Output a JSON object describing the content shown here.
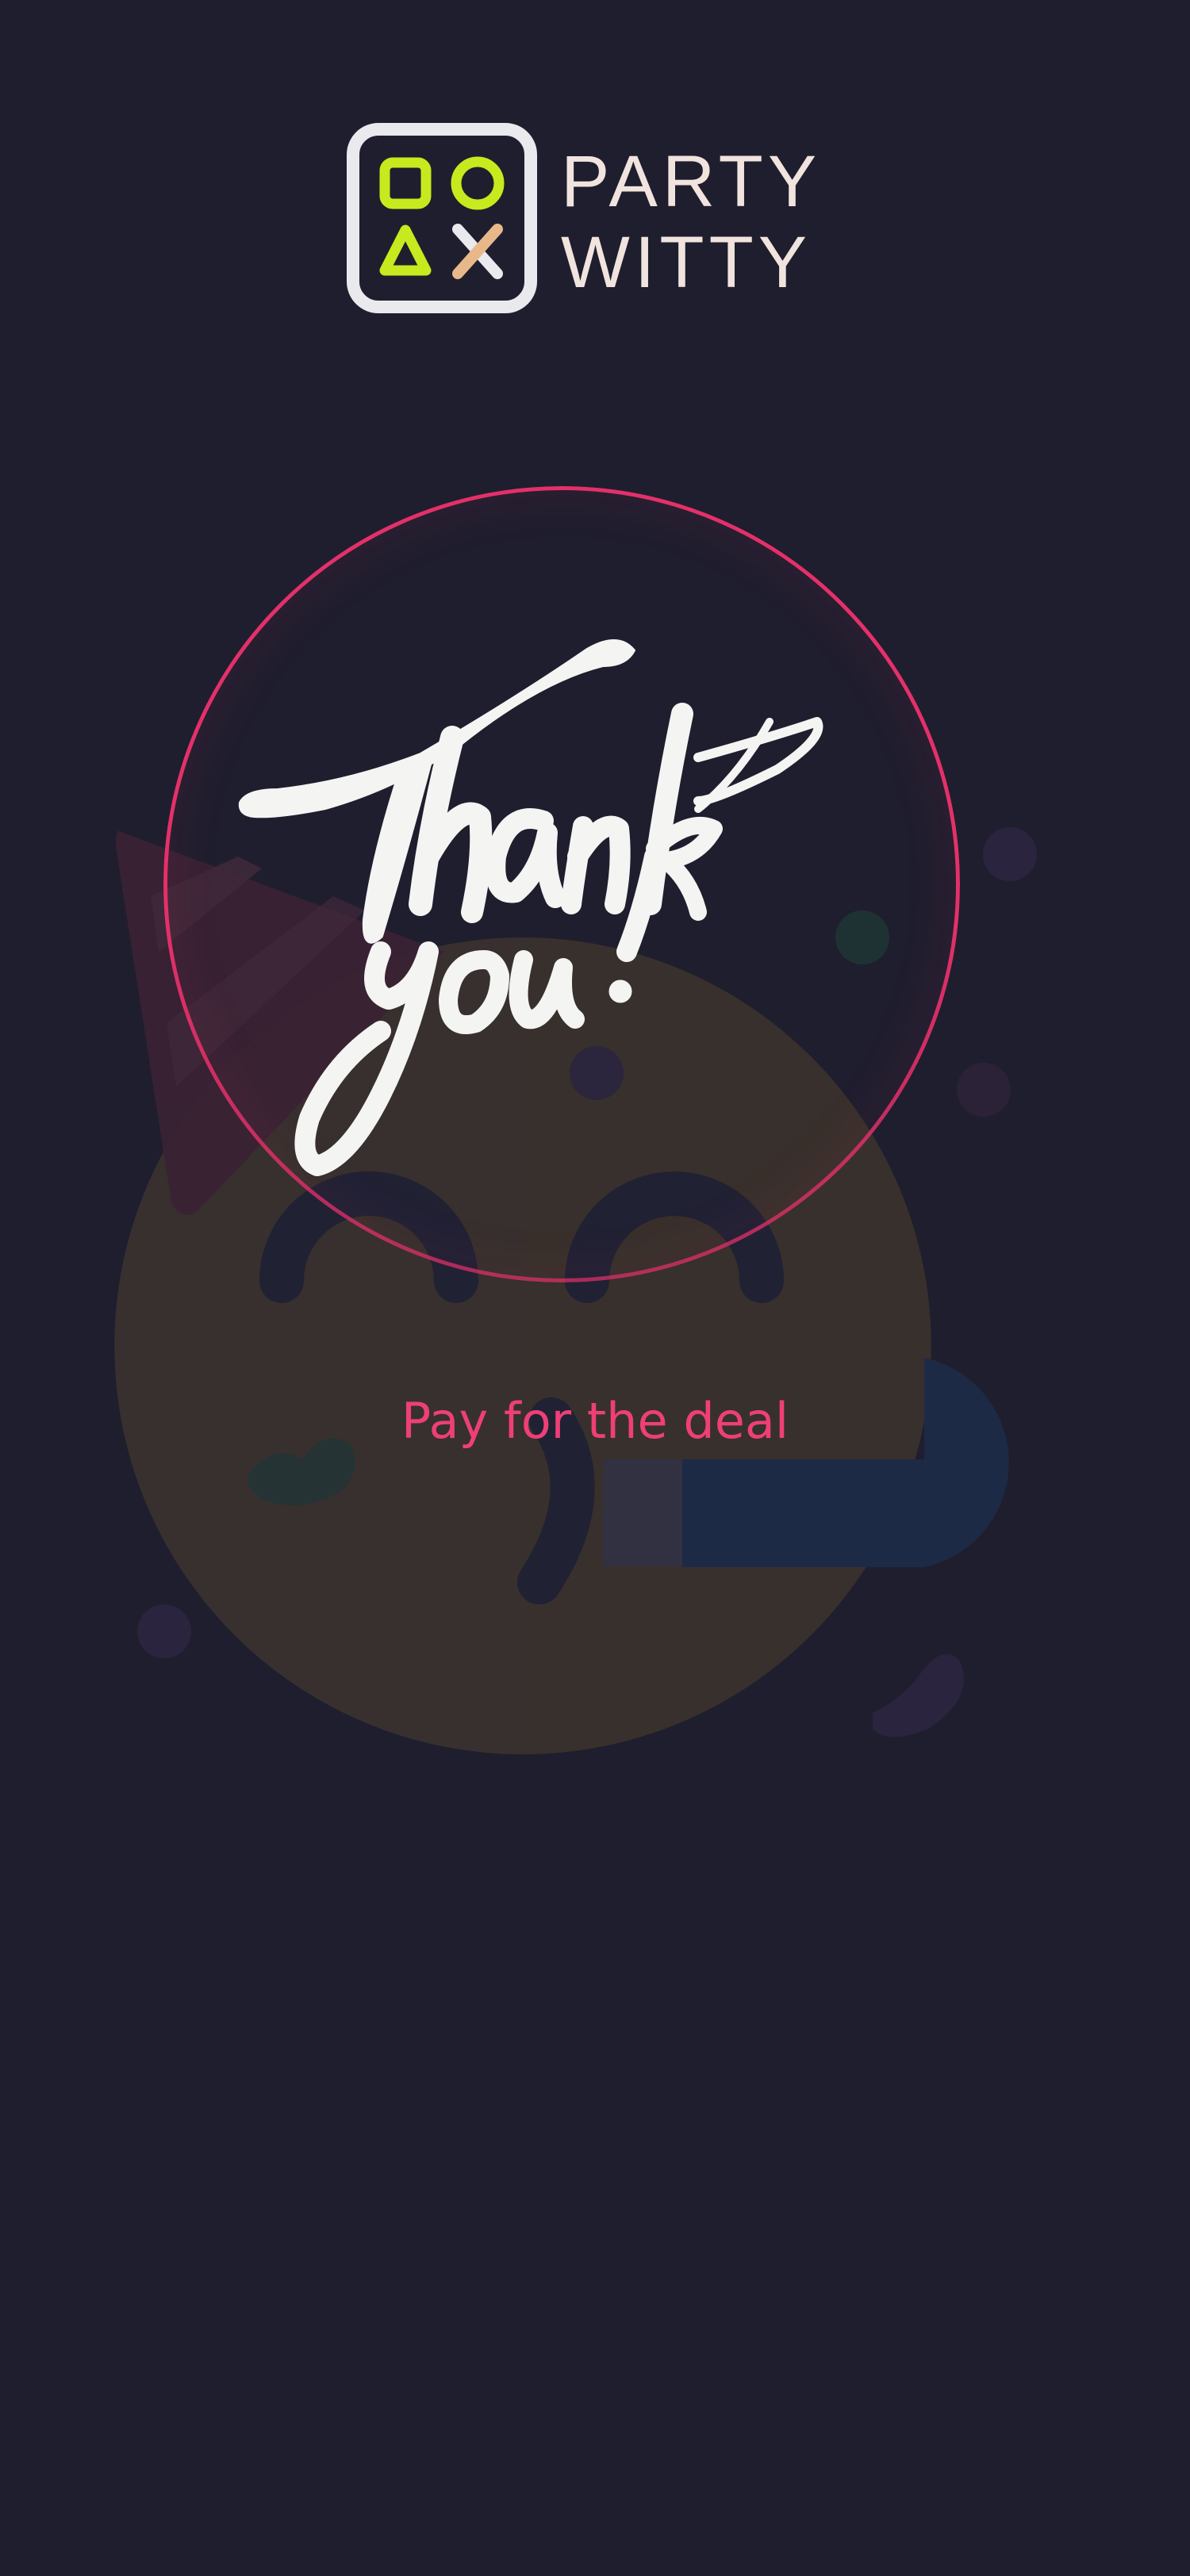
{
  "brand": {
    "line1": "PARTY",
    "line2": "WITTY",
    "colors": {
      "mark_frame": "#e9e9ee",
      "mark_bg": "#1f1e2e",
      "shapes": "#c6ea1e",
      "cross_accent": "#e9b88a",
      "wordmark": "#f1e4de"
    }
  },
  "hero": {
    "script_text": "Thank you!",
    "ring_color": "#e4306a"
  },
  "cta": {
    "label": "Pay for the deal",
    "color": "#ee3f77"
  },
  "theme": {
    "background": "#1f1e2e"
  }
}
